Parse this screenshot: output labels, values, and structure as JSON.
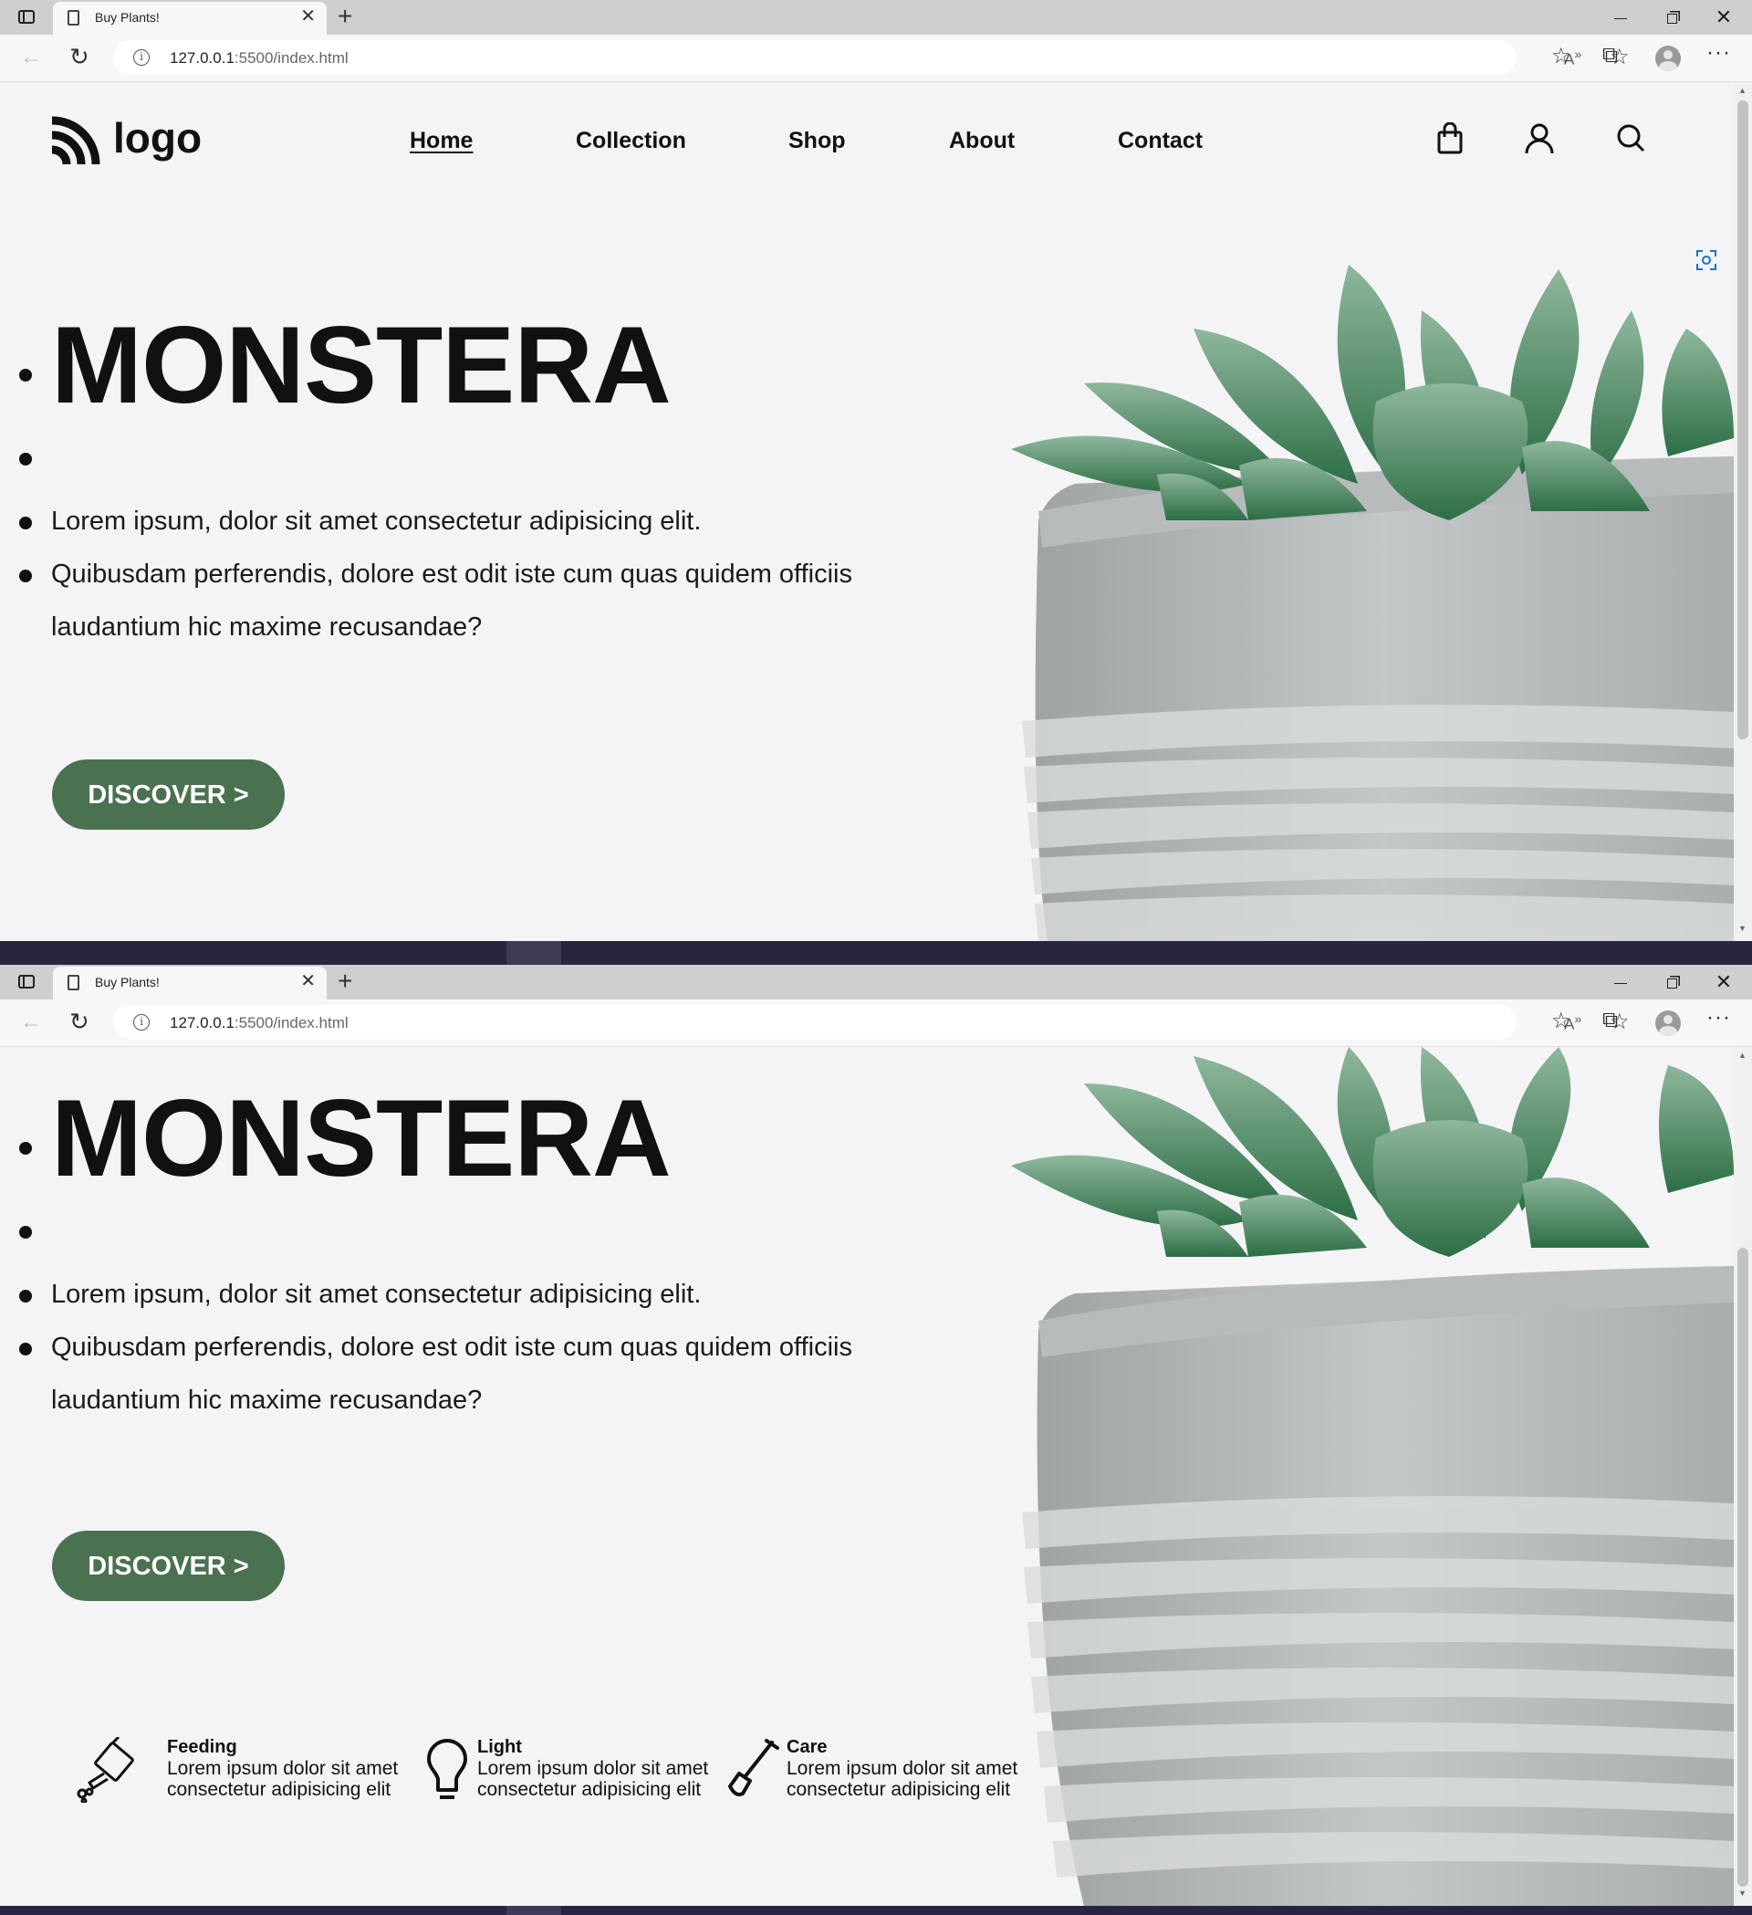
{
  "browser": {
    "tab_title": "Buy Plants!",
    "url_host": "127.0.0.1",
    "url_rest": ":5500/index.html"
  },
  "site": {
    "logo_text": "logo",
    "nav": [
      "Home",
      "Collection",
      "Shop",
      "About",
      "Contact"
    ],
    "active_nav": "Home",
    "header_icons": [
      "shopping-bag-icon",
      "user-icon",
      "search-icon"
    ]
  },
  "hero": {
    "title": "MONSTERA",
    "line1": "Lorem ipsum, dolor sit amet consectetur adipisicing elit.",
    "line2": "Quibusdam perferendis, dolore est odit iste cum quas quidem officiis laudantium hic maxime recusandae?",
    "cta": "DISCOVER >"
  },
  "features": [
    {
      "title": "Feeding",
      "desc": "Lorem ipsum dolor sit amet consectetur adipisicing elit",
      "icon": "watering-can-icon"
    },
    {
      "title": "Light",
      "desc": "Lorem ipsum dolor sit amet consectetur adipisicing elit",
      "icon": "light-bulb-icon"
    },
    {
      "title": "Care",
      "desc": "Lorem ipsum dolor sit amet consectetur adipisicing elit",
      "icon": "shovel-icon"
    }
  ],
  "colors": {
    "accent": "#4a7150",
    "page_bg": "#f4f4f7",
    "text": "#111111"
  }
}
